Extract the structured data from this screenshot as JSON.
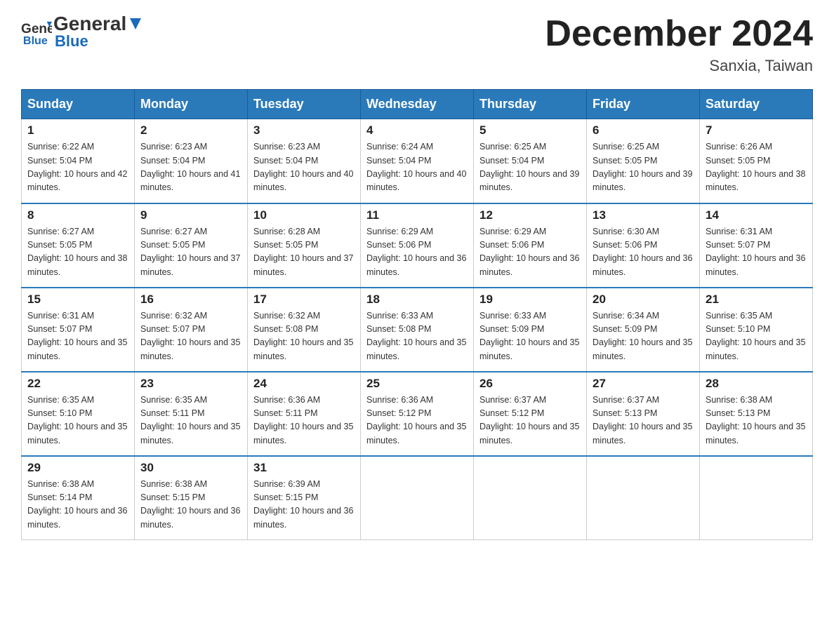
{
  "header": {
    "logo_general": "General",
    "logo_blue": "Blue",
    "month_title": "December 2024",
    "location": "Sanxia, Taiwan"
  },
  "days_of_week": [
    "Sunday",
    "Monday",
    "Tuesday",
    "Wednesday",
    "Thursday",
    "Friday",
    "Saturday"
  ],
  "weeks": [
    [
      {
        "day": "1",
        "sunrise": "6:22 AM",
        "sunset": "5:04 PM",
        "daylight": "10 hours and 42 minutes."
      },
      {
        "day": "2",
        "sunrise": "6:23 AM",
        "sunset": "5:04 PM",
        "daylight": "10 hours and 41 minutes."
      },
      {
        "day": "3",
        "sunrise": "6:23 AM",
        "sunset": "5:04 PM",
        "daylight": "10 hours and 40 minutes."
      },
      {
        "day": "4",
        "sunrise": "6:24 AM",
        "sunset": "5:04 PM",
        "daylight": "10 hours and 40 minutes."
      },
      {
        "day": "5",
        "sunrise": "6:25 AM",
        "sunset": "5:04 PM",
        "daylight": "10 hours and 39 minutes."
      },
      {
        "day": "6",
        "sunrise": "6:25 AM",
        "sunset": "5:05 PM",
        "daylight": "10 hours and 39 minutes."
      },
      {
        "day": "7",
        "sunrise": "6:26 AM",
        "sunset": "5:05 PM",
        "daylight": "10 hours and 38 minutes."
      }
    ],
    [
      {
        "day": "8",
        "sunrise": "6:27 AM",
        "sunset": "5:05 PM",
        "daylight": "10 hours and 38 minutes."
      },
      {
        "day": "9",
        "sunrise": "6:27 AM",
        "sunset": "5:05 PM",
        "daylight": "10 hours and 37 minutes."
      },
      {
        "day": "10",
        "sunrise": "6:28 AM",
        "sunset": "5:05 PM",
        "daylight": "10 hours and 37 minutes."
      },
      {
        "day": "11",
        "sunrise": "6:29 AM",
        "sunset": "5:06 PM",
        "daylight": "10 hours and 36 minutes."
      },
      {
        "day": "12",
        "sunrise": "6:29 AM",
        "sunset": "5:06 PM",
        "daylight": "10 hours and 36 minutes."
      },
      {
        "day": "13",
        "sunrise": "6:30 AM",
        "sunset": "5:06 PM",
        "daylight": "10 hours and 36 minutes."
      },
      {
        "day": "14",
        "sunrise": "6:31 AM",
        "sunset": "5:07 PM",
        "daylight": "10 hours and 36 minutes."
      }
    ],
    [
      {
        "day": "15",
        "sunrise": "6:31 AM",
        "sunset": "5:07 PM",
        "daylight": "10 hours and 35 minutes."
      },
      {
        "day": "16",
        "sunrise": "6:32 AM",
        "sunset": "5:07 PM",
        "daylight": "10 hours and 35 minutes."
      },
      {
        "day": "17",
        "sunrise": "6:32 AM",
        "sunset": "5:08 PM",
        "daylight": "10 hours and 35 minutes."
      },
      {
        "day": "18",
        "sunrise": "6:33 AM",
        "sunset": "5:08 PM",
        "daylight": "10 hours and 35 minutes."
      },
      {
        "day": "19",
        "sunrise": "6:33 AM",
        "sunset": "5:09 PM",
        "daylight": "10 hours and 35 minutes."
      },
      {
        "day": "20",
        "sunrise": "6:34 AM",
        "sunset": "5:09 PM",
        "daylight": "10 hours and 35 minutes."
      },
      {
        "day": "21",
        "sunrise": "6:35 AM",
        "sunset": "5:10 PM",
        "daylight": "10 hours and 35 minutes."
      }
    ],
    [
      {
        "day": "22",
        "sunrise": "6:35 AM",
        "sunset": "5:10 PM",
        "daylight": "10 hours and 35 minutes."
      },
      {
        "day": "23",
        "sunrise": "6:35 AM",
        "sunset": "5:11 PM",
        "daylight": "10 hours and 35 minutes."
      },
      {
        "day": "24",
        "sunrise": "6:36 AM",
        "sunset": "5:11 PM",
        "daylight": "10 hours and 35 minutes."
      },
      {
        "day": "25",
        "sunrise": "6:36 AM",
        "sunset": "5:12 PM",
        "daylight": "10 hours and 35 minutes."
      },
      {
        "day": "26",
        "sunrise": "6:37 AM",
        "sunset": "5:12 PM",
        "daylight": "10 hours and 35 minutes."
      },
      {
        "day": "27",
        "sunrise": "6:37 AM",
        "sunset": "5:13 PM",
        "daylight": "10 hours and 35 minutes."
      },
      {
        "day": "28",
        "sunrise": "6:38 AM",
        "sunset": "5:13 PM",
        "daylight": "10 hours and 35 minutes."
      }
    ],
    [
      {
        "day": "29",
        "sunrise": "6:38 AM",
        "sunset": "5:14 PM",
        "daylight": "10 hours and 36 minutes."
      },
      {
        "day": "30",
        "sunrise": "6:38 AM",
        "sunset": "5:15 PM",
        "daylight": "10 hours and 36 minutes."
      },
      {
        "day": "31",
        "sunrise": "6:39 AM",
        "sunset": "5:15 PM",
        "daylight": "10 hours and 36 minutes."
      },
      null,
      null,
      null,
      null
    ]
  ],
  "labels": {
    "sunrise_prefix": "Sunrise: ",
    "sunset_prefix": "Sunset: ",
    "daylight_prefix": "Daylight: "
  }
}
